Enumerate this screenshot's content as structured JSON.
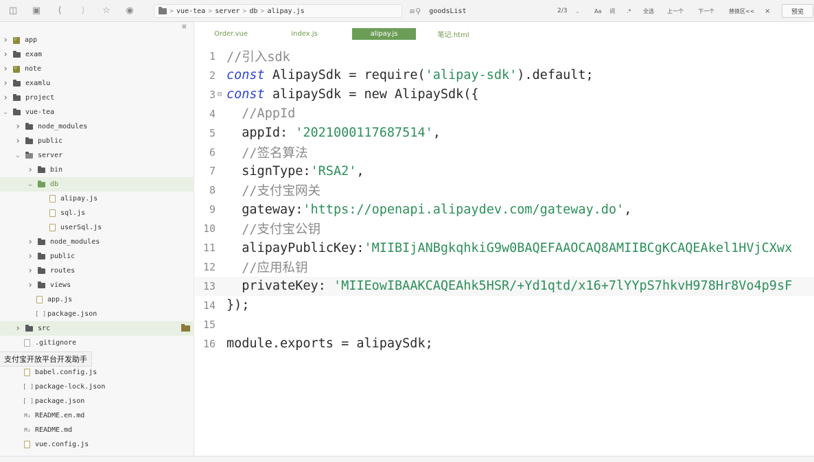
{
  "toolbar": {
    "icons": [
      "window-icon",
      "save-icon",
      "back-icon",
      "forward-icon",
      "star-icon",
      "run-icon"
    ],
    "breadcrumb": [
      "vue-tea",
      "server",
      "db",
      "alipay.js"
    ],
    "search_value": "goodsList",
    "match_count": "2/3",
    "options": [
      "Aa",
      "词",
      ".*",
      "全选",
      "上一个",
      "下一个",
      "替换区<<",
      "×"
    ],
    "preview_label": "预览"
  },
  "sidebar": {
    "tree": [
      {
        "label": "app",
        "kind": "project",
        "depth": 0,
        "caret": ">"
      },
      {
        "label": "exam",
        "kind": "folder",
        "depth": 0,
        "caret": ">"
      },
      {
        "label": "note",
        "kind": "project",
        "depth": 0,
        "caret": ">"
      },
      {
        "label": "examlu",
        "kind": "folder",
        "depth": 0,
        "caret": ">"
      },
      {
        "label": "project",
        "kind": "folder",
        "depth": 0,
        "caret": ">"
      },
      {
        "label": "vue-tea",
        "kind": "folder",
        "depth": 0,
        "caret": "v"
      },
      {
        "label": "node_modules",
        "kind": "folder",
        "depth": 1,
        "caret": ">"
      },
      {
        "label": "public",
        "kind": "folder",
        "depth": 1,
        "caret": ">"
      },
      {
        "label": "server",
        "kind": "folder-open",
        "depth": 1,
        "caret": "v"
      },
      {
        "label": "bin",
        "kind": "folder",
        "depth": 2,
        "caret": ">"
      },
      {
        "label": "db",
        "kind": "folder-open-green",
        "depth": 2,
        "caret": "v",
        "selected": true
      },
      {
        "label": "alipay.js",
        "kind": "file",
        "depth": 3
      },
      {
        "label": "sql.js",
        "kind": "file",
        "depth": 3
      },
      {
        "label": "userSql.js",
        "kind": "file",
        "depth": 3
      },
      {
        "label": "node_modules",
        "kind": "folder",
        "depth": 2,
        "caret": ">"
      },
      {
        "label": "public",
        "kind": "folder",
        "depth": 2,
        "caret": ">"
      },
      {
        "label": "routes",
        "kind": "folder",
        "depth": 2,
        "caret": ">"
      },
      {
        "label": "views",
        "kind": "folder",
        "depth": 2,
        "caret": ">"
      },
      {
        "label": "app.js",
        "kind": "file",
        "depth": 2
      },
      {
        "label": "package.json",
        "kind": "json",
        "depth": 2
      },
      {
        "label": "src",
        "kind": "folder",
        "depth": 1,
        "caret": ">",
        "selected": true
      },
      {
        "label": ".gitignore",
        "kind": "file-gray",
        "depth": 1
      },
      {
        "label": "babel.config.js",
        "kind": "file",
        "depth": 1
      },
      {
        "label": "package-lock.json",
        "kind": "json",
        "depth": 1
      },
      {
        "label": "package.json",
        "kind": "json",
        "depth": 1
      },
      {
        "label": "README.en.md",
        "kind": "md",
        "depth": 1
      },
      {
        "label": "README.md",
        "kind": "md",
        "depth": 1
      },
      {
        "label": "vue.config.js",
        "kind": "file",
        "depth": 1
      }
    ],
    "tooltip": "支付宝开放平台开发助手"
  },
  "editor": {
    "tabs": [
      {
        "label": "Order.vue",
        "active": false
      },
      {
        "label": "index.js",
        "active": false
      },
      {
        "label": "alipay.js",
        "active": true
      },
      {
        "label": "笔记.html",
        "active": false
      }
    ],
    "lines": [
      [
        {
          "t": "//引入sdk",
          "c": "cm"
        }
      ],
      [
        {
          "t": "const",
          "c": "kw"
        },
        {
          "t": " AlipaySdk = require(",
          "c": "id"
        },
        {
          "t": "'alipay-sdk'",
          "c": "str"
        },
        {
          "t": ").default;",
          "c": "id"
        }
      ],
      [
        {
          "t": "const",
          "c": "kw"
        },
        {
          "t": " alipaySdk = new AlipaySdk({",
          "c": "id"
        }
      ],
      [
        {
          "t": "  //AppId",
          "c": "cm"
        }
      ],
      [
        {
          "t": "  appId: ",
          "c": "key"
        },
        {
          "t": "'2021000117687514'",
          "c": "str"
        },
        {
          "t": ",",
          "c": "pn"
        }
      ],
      [
        {
          "t": "  //签名算法",
          "c": "cm"
        }
      ],
      [
        {
          "t": "  signType:",
          "c": "key"
        },
        {
          "t": "'RSA2'",
          "c": "str"
        },
        {
          "t": ",",
          "c": "pn"
        }
      ],
      [
        {
          "t": "  //支付宝网关",
          "c": "cm"
        }
      ],
      [
        {
          "t": "  gateway:",
          "c": "key"
        },
        {
          "t": "'https://openapi.alipaydev.com/gateway.do'",
          "c": "str"
        },
        {
          "t": ",",
          "c": "pn"
        }
      ],
      [
        {
          "t": "  //支付宝公钥",
          "c": "cm"
        }
      ],
      [
        {
          "t": "  alipayPublicKey:",
          "c": "key"
        },
        {
          "t": "'MIIBIjANBgkqhkiG9w0BAQEFAAOCAQ8AMIIBCgKCAQEAkel1HVjCXwx",
          "c": "str"
        }
      ],
      [
        {
          "t": "  //应用私钥",
          "c": "cm"
        }
      ],
      [
        {
          "t": "  privateKey: ",
          "c": "key"
        },
        {
          "t": "'MIIEowIBAAKCAQEAhk5HSR/+Yd1qtd/x16+7lYYpS7hkvH978Hr8Vo4p9sF",
          "c": "str"
        }
      ],
      [
        {
          "t": "});",
          "c": "id"
        }
      ],
      [],
      [
        {
          "t": "module.exports = alipaySdk;",
          "c": "id"
        }
      ]
    ],
    "highlighted_line": 13
  }
}
